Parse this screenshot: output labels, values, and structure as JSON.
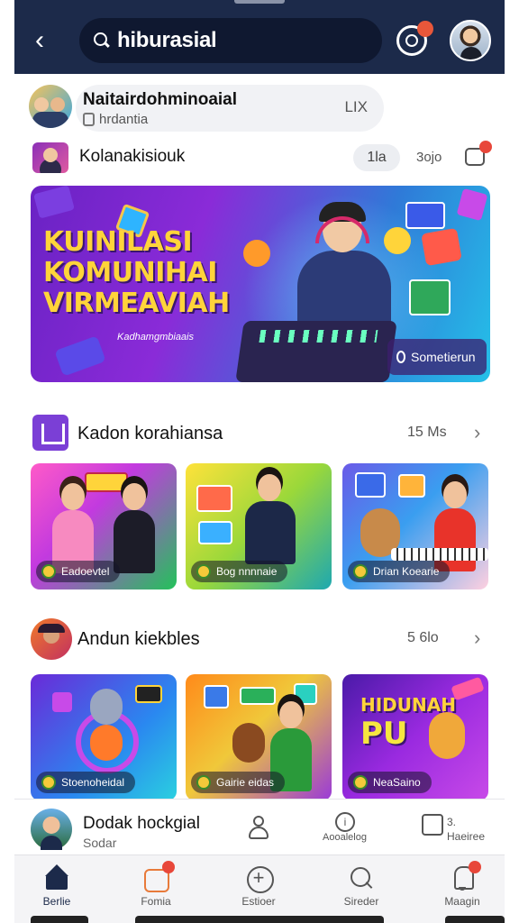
{
  "header": {
    "search_value": "hiburasial",
    "notification_badge": "",
    "colors": {
      "bar": "#1c2a4a",
      "accent": "#e8573a"
    }
  },
  "user_card": {
    "name": "Naitairdohminoaial",
    "subtitle": "hrdantia",
    "tag": "LIX"
  },
  "channel": {
    "name": "Kolanakisiouk",
    "chip": "1la",
    "count": "3ojo"
  },
  "hero": {
    "title_lines": [
      "KUINILASI",
      "KOMUNIHAI",
      "VIRMEAVIAH"
    ],
    "subtitle": "Kadhamgmbiaais",
    "button_label": "Sometierun"
  },
  "section1": {
    "title": "Kadon korahiansa",
    "count": "15 Ms",
    "cards": [
      {
        "label": "Eadoevtel"
      },
      {
        "label": "Bog nnnnaie"
      },
      {
        "label": "Drian Koearie"
      }
    ]
  },
  "section2": {
    "title": "Andun kiekbles",
    "count": "5 6lo",
    "cards": [
      {
        "label": "Stoenoheidal"
      },
      {
        "label": "Gairie eidas"
      },
      {
        "label": "NeaSaino",
        "big_lines": [
          "HIDUNAH",
          "PU"
        ]
      }
    ]
  },
  "profile_row": {
    "name": "Dodak hockgial",
    "subtitle": "Sodar",
    "info_label": "Aooalelog",
    "box_top": "3.",
    "box_label": "Haeiree"
  },
  "tabbar": {
    "tabs": [
      {
        "label": "Berlie",
        "icon": "home-icon"
      },
      {
        "label": "Fomia",
        "icon": "game-icon"
      },
      {
        "label": "Estioer",
        "icon": "plus-icon"
      },
      {
        "label": "Sireder",
        "icon": "search-icon"
      },
      {
        "label": "Maagin",
        "icon": "bell-icon"
      }
    ]
  }
}
